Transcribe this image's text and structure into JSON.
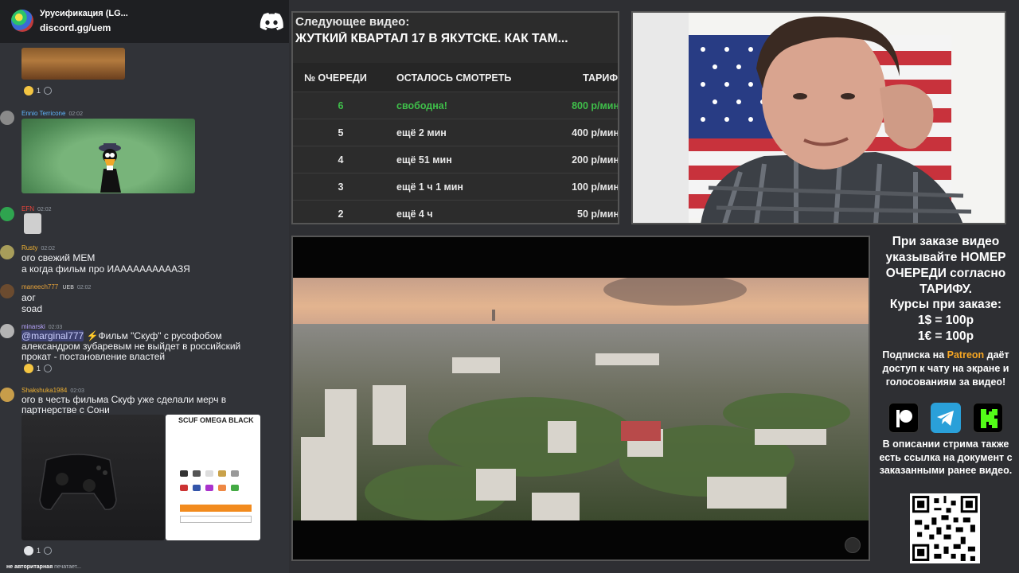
{
  "chat": {
    "server_name": "Урусификация (LG...",
    "server_invite": "discord.gg/uem",
    "messages": [
      {
        "user": "Ennio Terricone",
        "time": "02:02",
        "user_color": "#5fb6ff"
      },
      {
        "user": "EFN",
        "time": "02:02",
        "user_color": "#e8443a"
      },
      {
        "user": "Rusty",
        "time": "02:02",
        "user_color": "#f0b232",
        "lines": [
          "ого свежий МЕМ",
          "а когда фильм про ИААААААААААЗЯ"
        ]
      },
      {
        "user": "maneech777",
        "badge": "UEB",
        "time": "02:02",
        "user_color": "#e8a33a",
        "lines": [
          "аог",
          "soad"
        ]
      },
      {
        "user": "minarski",
        "time": "02:03",
        "user_color": "#b8a6ff",
        "mention": "@marginal777",
        "line1_rest": " ⚡Фильм \"Скуф\" с русофобом",
        "lines": [
          "александром зубаревым не выйдет в российский",
          "прокат - постановление властей"
        ]
      },
      {
        "user": "Shakshuka1984",
        "time": "02:03",
        "user_color": "#f0b232",
        "lines": [
          "ого в честь фильма Скуф уже сделали мерч в",
          "партнерстве с Сони"
        ]
      }
    ],
    "reactions": [
      {
        "count": "1"
      },
      {
        "count": "1"
      },
      {
        "count": "1"
      }
    ],
    "shop_title": "SCUF OMEGA BLACK",
    "typing_user": "не авторитарная",
    "typing_text": " печатает..."
  },
  "queue": {
    "next_label": "Следующее видео:",
    "next_title": "ЖУТКИЙ КВАРТАЛ 17 В ЯКУТСКЕ. КАК ТАМ...",
    "headers": {
      "num": "№ ОЧЕРЕДИ",
      "left": "ОСТАЛОСЬ СМОТРЕТЬ",
      "tariff": "ТАРИФ"
    },
    "rows": [
      {
        "num": "6",
        "left": "свободна!",
        "tariff": "800 р/мин",
        "highlight": true
      },
      {
        "num": "5",
        "left": "ещё 2 мин",
        "tariff": "400 р/мин"
      },
      {
        "num": "4",
        "left": "ещё 51 мин",
        "tariff": "200 р/мин"
      },
      {
        "num": "3",
        "left": "ещё 1 ч 1 мин",
        "tariff": "100 р/мин"
      },
      {
        "num": "2",
        "left": "ещё 4 ч",
        "tariff": "50 р/мин"
      }
    ],
    "highlight_color": "#3fbf4a"
  },
  "info": {
    "order_text": "При заказе видео указывайте НОМЕР ОЧЕРЕДИ согласно ТАРИФУ.",
    "rates_title": "Курсы при заказе:",
    "rate_usd": "1$ = 100р",
    "rate_eur": "1€ = 100р",
    "sub_prefix": "Подписка на ",
    "sub_patreon": "Patreon",
    "sub_rest": " даёт доступ к чату на экране и голосованиям за видео!",
    "desc": "В описании стрима также есть ссылка на документ с заказанными ранее видео.",
    "patreon_color": "#f6a623",
    "socials": [
      "patreon-icon",
      "telegram-icon",
      "kick-icon"
    ]
  }
}
